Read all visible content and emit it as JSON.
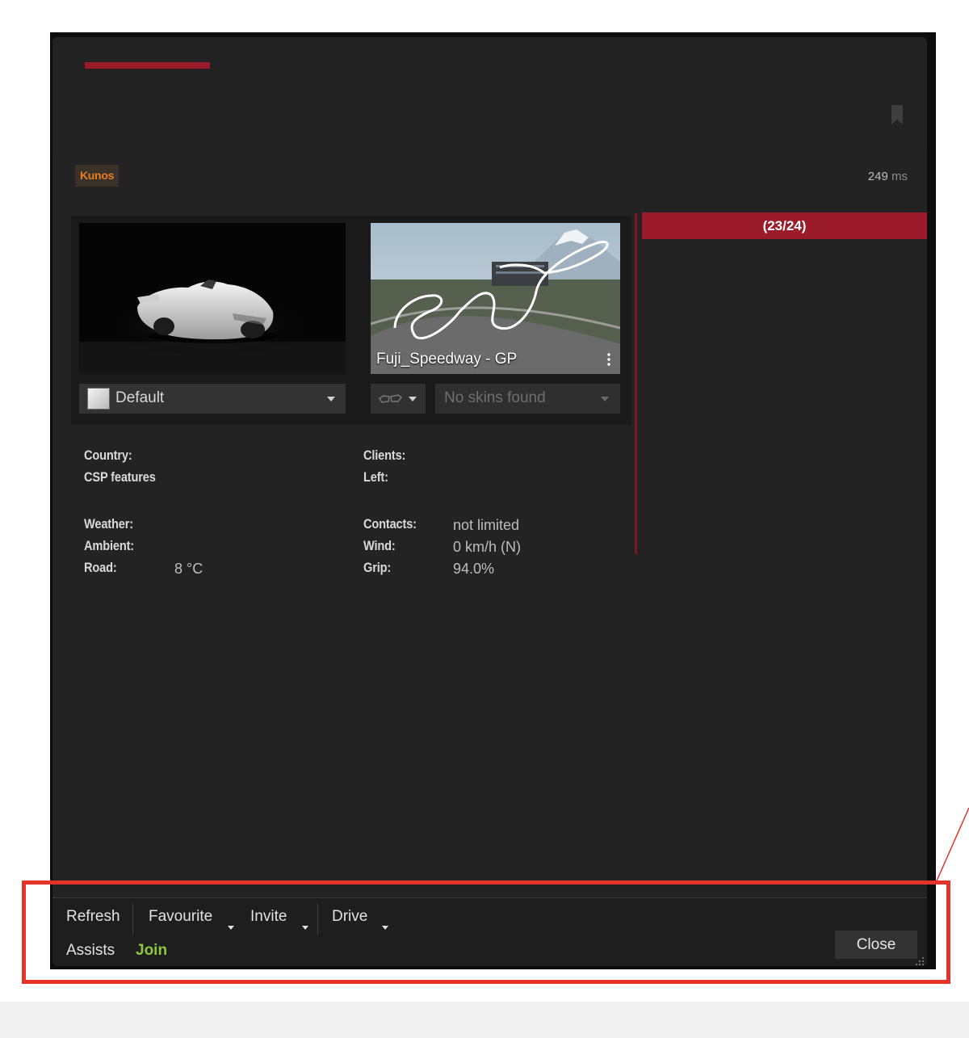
{
  "header": {
    "accent_color": "#9c1b2a",
    "bookmark_icon": "bookmark-icon"
  },
  "server": {
    "badge": "Kunos",
    "ping_value": "249",
    "ping_unit": "ms",
    "slots": "(23/24)"
  },
  "car": {
    "skin_selected": "Default"
  },
  "track": {
    "name": "Fuji_Speedway - GP",
    "skin_placeholder": "No skins found",
    "glasses_icon": "glasses-icon",
    "menu_icon": "more-vertical-icon"
  },
  "info": {
    "left": [
      {
        "label": "Country:",
        "value": ""
      },
      {
        "label": "CSP features",
        "value": ""
      },
      {
        "label": "Weather:",
        "value": ""
      },
      {
        "label": "Ambient:",
        "value": ""
      },
      {
        "label": "Road:",
        "value": "8 °C"
      }
    ],
    "right": [
      {
        "label": "Clients:",
        "value": ""
      },
      {
        "label": "Left:",
        "value": ""
      },
      {
        "label": "Contacts:",
        "value": "not limited"
      },
      {
        "label": "Wind:",
        "value": "0 km/h (N)"
      },
      {
        "label": "Grip:",
        "value": "94.0%"
      }
    ]
  },
  "footer": {
    "refresh": "Refresh",
    "favourite": "Favourite",
    "invite": "Invite",
    "drive": "Drive",
    "assists": "Assists",
    "join": "Join",
    "close": "Close",
    "join_color": "#8dc63f"
  },
  "annotation": {
    "highlight_color": "#e5332a"
  }
}
